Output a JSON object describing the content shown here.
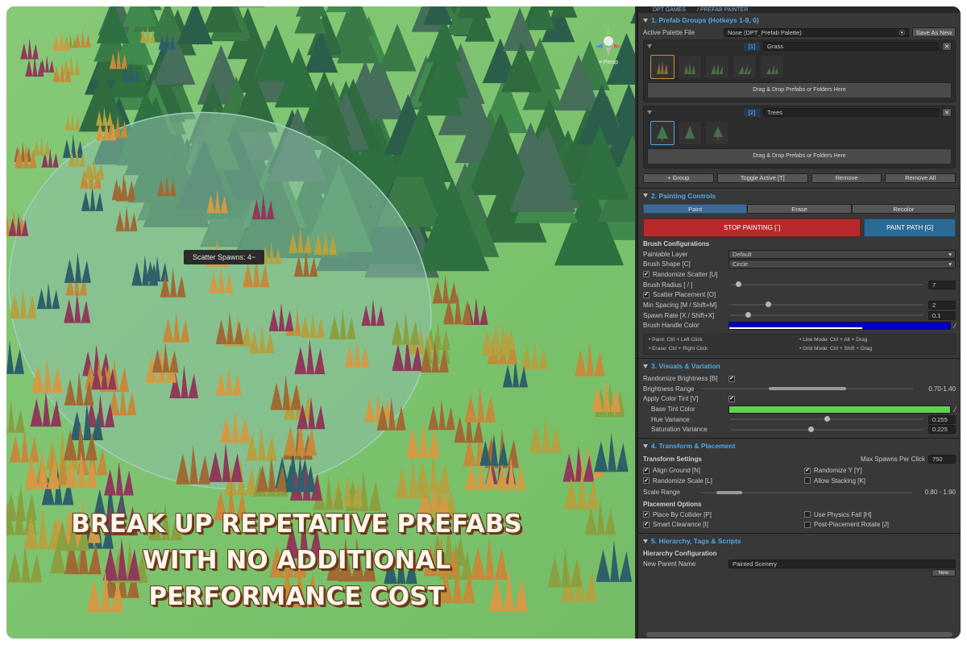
{
  "scene": {
    "tooltip": "Scatter Spawns: 4~",
    "gizmo_label": "≡ Persp",
    "caption_lines": [
      "BREAK UP REPETATIVE PREFABS",
      "WITH NO ADDITIONAL",
      "PERFORMANCE COST"
    ]
  },
  "panel": {
    "topbar": [
      "DPT GAMES",
      "/ PREFAB PAINTER"
    ],
    "prefab_groups": {
      "title": "1. Prefab Groups (Hotkeys 1-9, 0)",
      "palette_label": "Active Palette File",
      "palette_value": "None (DPT_Prefab Palette)",
      "save_as_new": "Save As New",
      "groups": [
        {
          "index": "[1]",
          "name": "Grass",
          "thumb_count": 5,
          "drop": "Drag & Drop Prefabs or Folders Here"
        },
        {
          "index": "[2]",
          "name": "Trees",
          "thumb_count": 3,
          "drop": "Drag & Drop Prefabs or Folders Here"
        }
      ],
      "buttons": [
        "+ Group",
        "Toggle Active [T]",
        "Remove",
        "Remove All"
      ]
    },
    "painting_controls": {
      "title": "2. Painting Controls",
      "modes": [
        "Paint",
        "Erase",
        "Recolor"
      ],
      "stop": "STOP PAINTING [`]",
      "path": "PAINT PATH [G]",
      "brush_config": "Brush Configurations",
      "paintable_layer_label": "Paintable Layer",
      "paintable_layer_value": "Default",
      "brush_shape_label": "Brush Shape [C]",
      "brush_shape_value": "Circle",
      "randomize_scatter": "Randomize Scatter [U]",
      "brush_radius_label": "Brush Radius [ / ]",
      "brush_radius_value": "7",
      "brush_radius_frac": 0.05,
      "scatter_placement": "Scatter Placement [O]",
      "min_spacing_label": "Min Spacing [M / Shift+M]",
      "min_spacing_value": "2",
      "min_spacing_frac": 0.2,
      "spawn_rate_label": "Spawn Rate [X / Shift+X]",
      "spawn_rate_value": "0.1",
      "spawn_rate_frac": 0.1,
      "handle_color_label": "Brush Handle Color",
      "handle_color": "#0000c8",
      "help": [
        "• Paint: Ctrl + Left Click",
        "• Line Mode: Ctrl + Alt + Drag",
        "• Erase: Ctrl + Right Click",
        "• Grid Mode: Ctrl + Shift + Drag"
      ]
    },
    "visuals": {
      "title": "3. Visuals & Variation",
      "randomize_brightness": "Randomize Brightness [B]",
      "brightness_range_label": "Brightness Range",
      "brightness_range_value": "0.70-1.40",
      "brightness_min_frac": 0.32,
      "brightness_max_frac": 0.68,
      "apply_tint": "Apply Color Tint [V]",
      "base_tint_label": "Base Tint Color",
      "base_tint_color": "#5fd34f",
      "hue_label": "Hue Variance",
      "hue_value": "0.255",
      "hue_frac": 0.5,
      "sat_label": "Saturation Variance",
      "sat_value": "0.225",
      "sat_frac": 0.42
    },
    "transform": {
      "title": "4. Transform & Placement",
      "transform_settings": "Transform Settings",
      "max_spawns_label": "Max Spawns Per Click",
      "max_spawns_value": "750",
      "align_ground": "Align Ground [N]",
      "randomize_y": "Randomize Y [Y]",
      "randomize_scale": "Randomize Scale [L]",
      "allow_stacking": "Allow Stacking [K]",
      "scale_range_label": "Scale Range",
      "scale_range_value": "0.80 - 1.90",
      "scale_min_frac": 0.08,
      "scale_max_frac": 0.2,
      "placement_options": "Placement Options",
      "place_by_collider": "Place By Collider [P]",
      "use_physics_fall": "Use Physics Fall [H]",
      "smart_clearance": "Smart Clearance [I]",
      "post_rotate": "Post-Placement Rotate [J]"
    },
    "hierarchy": {
      "title": "5. Hierarchy, Tags & Scripts",
      "config": "Hierarchy Configuration",
      "parent_label": "New Parent Name",
      "parent_value": "Painted Scenery",
      "new_button": "New"
    }
  }
}
